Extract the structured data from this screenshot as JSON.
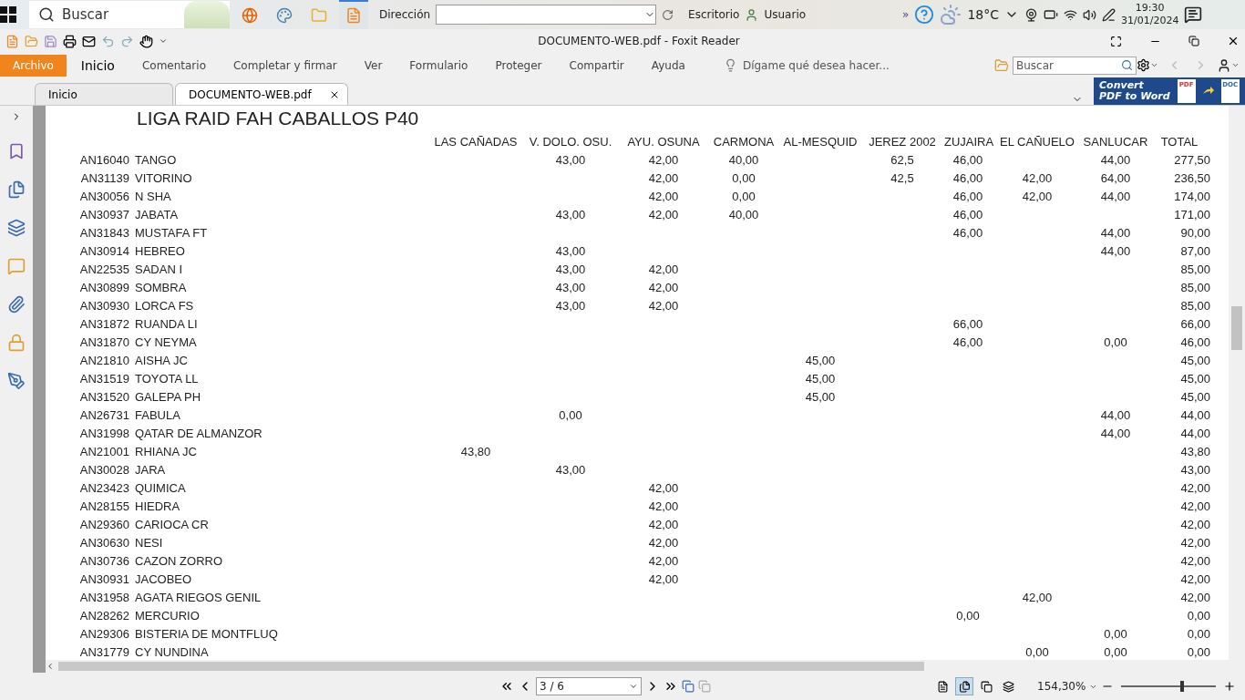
{
  "taskbar": {
    "search_placeholder": "Buscar",
    "address_label": "Dirección",
    "desktop_label": "Escritorio",
    "user_label": "Usuario",
    "chevrons": "»",
    "temperature": "18°C",
    "time": "19:30",
    "date": "31/01/2024"
  },
  "window": {
    "title": "DOCUMENTO-WEB.pdf - Foxit Reader"
  },
  "ribbon": {
    "tabs": [
      {
        "label": "Archivo",
        "kind": "file",
        "selected": false
      },
      {
        "label": "Inicio",
        "kind": "tab",
        "selected": true
      },
      {
        "label": "Comentario",
        "kind": "tab",
        "selected": false
      },
      {
        "label": "Completar y firmar",
        "kind": "tab",
        "selected": false
      },
      {
        "label": "Ver",
        "kind": "tab",
        "selected": false
      },
      {
        "label": "Formulario",
        "kind": "tab",
        "selected": false
      },
      {
        "label": "Proteger",
        "kind": "tab",
        "selected": false
      },
      {
        "label": "Compartir",
        "kind": "tab",
        "selected": false
      },
      {
        "label": "Ayuda",
        "kind": "tab",
        "selected": false
      }
    ],
    "tell_me": "Dígame qué desea hacer...",
    "search_placeholder": "Buscar"
  },
  "doc_tabs": [
    {
      "label": "Inicio",
      "selected": false
    },
    {
      "label": "DOCUMENTO-WEB.pdf",
      "selected": true
    }
  ],
  "banner": {
    "line1": "Convert",
    "line2": "PDF to Word",
    "from": "PDF",
    "to": "DOC"
  },
  "document": {
    "title": "LIGA RAID FAH CABALLOS P40",
    "columns": [
      "LAS CAÑADAS",
      "V. DOLO. OSU.",
      "AYU. OSUNA",
      "CARMONA",
      "AL-MESQUID",
      "JEREZ 2002",
      "ZUJAIRA",
      "EL CAÑUELO",
      "SANLUCAR",
      "TOTAL"
    ],
    "rows": [
      {
        "code": "AN16040",
        "name": "TANGO",
        "v_dolo_osu": "43,00",
        "ayu_osuna": "42,00",
        "carmona": "40,00",
        "jerez_2002": "62,5",
        "zujaira": "46,00",
        "sanlucar": "44,00",
        "total": "277,50"
      },
      {
        "code": "AN31139",
        "name": "VITORINO",
        "ayu_osuna": "42,00",
        "carmona": "0,00",
        "jerez_2002": "42,5",
        "zujaira": "46,00",
        "el_canuelo": "42,00",
        "sanlucar": "64,00",
        "total": "236,50"
      },
      {
        "code": "AN30056",
        "name": "N SHA",
        "ayu_osuna": "42,00",
        "carmona": "0,00",
        "zujaira": "46,00",
        "el_canuelo": "42,00",
        "sanlucar": "44,00",
        "total": "174,00"
      },
      {
        "code": "AN30937",
        "name": "JABATA",
        "v_dolo_osu": "43,00",
        "ayu_osuna": "42,00",
        "carmona": "40,00",
        "zujaira": "46,00",
        "total": "171,00"
      },
      {
        "code": "AN31843",
        "name": "MUSTAFA FT",
        "zujaira": "46,00",
        "sanlucar": "44,00",
        "total": "90,00"
      },
      {
        "code": "AN30914",
        "name": "HEBREO",
        "v_dolo_osu": "43,00",
        "sanlucar": "44,00",
        "total": "87,00"
      },
      {
        "code": "AN22535",
        "name": "SADAN I",
        "v_dolo_osu": "43,00",
        "ayu_osuna": "42,00",
        "total": "85,00"
      },
      {
        "code": "AN30899",
        "name": "SOMBRA",
        "v_dolo_osu": "43,00",
        "ayu_osuna": "42,00",
        "total": "85,00"
      },
      {
        "code": "AN30930",
        "name": "LORCA FS",
        "v_dolo_osu": "43,00",
        "ayu_osuna": "42,00",
        "total": "85,00"
      },
      {
        "code": "AN31872",
        "name": "RUANDA LI",
        "zujaira": "66,00",
        "total": "66,00"
      },
      {
        "code": "AN31870",
        "name": "CY NEYMA",
        "zujaira": "46,00",
        "sanlucar": "0,00",
        "total": "46,00"
      },
      {
        "code": "AN21810",
        "name": "AISHA JC",
        "al_mesquid": "45,00",
        "total": "45,00"
      },
      {
        "code": "AN31519",
        "name": "TOYOTA LL",
        "al_mesquid": "45,00",
        "total": "45,00"
      },
      {
        "code": "AN31520",
        "name": "GALEPA PH",
        "al_mesquid": "45,00",
        "total": "45,00"
      },
      {
        "code": "AN26731",
        "name": "FABULA",
        "v_dolo_osu": "0,00",
        "sanlucar": "44,00",
        "total": "44,00"
      },
      {
        "code": "AN31998",
        "name": "QATAR DE ALMANZOR",
        "sanlucar": "44,00",
        "total": "44,00"
      },
      {
        "code": "AN21001",
        "name": "RHIANA JC",
        "las_canadas": "43,80",
        "total": "43,80"
      },
      {
        "code": "AN30028",
        "name": "JARA",
        "v_dolo_osu": "43,00",
        "total": "43,00"
      },
      {
        "code": "AN23423",
        "name": "QUIMICA",
        "ayu_osuna": "42,00",
        "total": "42,00"
      },
      {
        "code": "AN28155",
        "name": "HIEDRA",
        "ayu_osuna": "42,00",
        "total": "42,00"
      },
      {
        "code": "AN29360",
        "name": "CARIOCA CR",
        "ayu_osuna": "42,00",
        "total": "42,00"
      },
      {
        "code": "AN30630",
        "name": "NESI",
        "ayu_osuna": "42,00",
        "total": "42,00"
      },
      {
        "code": "AN30736",
        "name": "CAZON ZORRO",
        "ayu_osuna": "42,00",
        "total": "42,00"
      },
      {
        "code": "AN30931",
        "name": "JACOBEO",
        "ayu_osuna": "42,00",
        "total": "42,00"
      },
      {
        "code": "AN31958",
        "name": "AGATA RIEGOS GENIL",
        "el_canuelo": "42,00",
        "total": "42,00"
      },
      {
        "code": "AN28262",
        "name": "MERCURIO",
        "zujaira": "0,00",
        "total": "0,00"
      },
      {
        "code": "AN29306",
        "name": "BISTERIA DE MONTFLUQ",
        "sanlucar": "0,00",
        "total": "0,00"
      },
      {
        "code": "AN31779",
        "name": "CY NUNDINA",
        "el_canuelo": "0,00",
        "sanlucar": "0,00",
        "total": "0,00"
      }
    ]
  },
  "status_bar": {
    "page": "3 / 6",
    "zoom": "154,30%",
    "zoom_level": {
      "level": 0.62
    },
    "views": [
      {
        "kind": "single",
        "selected": false
      },
      {
        "kind": "continuous",
        "selected": true
      },
      {
        "kind": "facing",
        "selected": false
      },
      {
        "kind": "cont-facing",
        "selected": false
      }
    ]
  }
}
